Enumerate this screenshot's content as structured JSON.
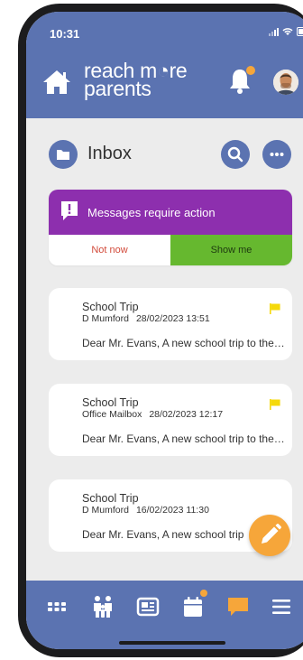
{
  "status_bar": {
    "time": "10:31"
  },
  "header": {
    "logo_line1": "reach m◔re",
    "logo_line2": "parents"
  },
  "inbox": {
    "title": "Inbox"
  },
  "banner": {
    "message": "Messages require action",
    "not_now_label": "Not now",
    "show_me_label": "Show me"
  },
  "messages": [
    {
      "subject": "School Trip",
      "sender": "D Mumford",
      "datetime": "28/02/2023 13:51",
      "preview": "Dear Mr. Evans, A new school trip to the Science Museum",
      "flagged": true
    },
    {
      "subject": "School Trip",
      "sender": "Office Mailbox",
      "datetime": "28/02/2023 12:17",
      "preview": "Dear Mr. Evans, A new school trip to the Science Museum",
      "flagged": true
    },
    {
      "subject": "School Trip",
      "sender": "D Mumford",
      "datetime": "16/02/2023 11:30",
      "preview": "Dear Mr. Evans, A new school trip",
      "flagged": false
    }
  ],
  "colors": {
    "primary": "#5b73b1",
    "banner_purple": "#8d2fae",
    "action_green": "#66b82f",
    "accent_orange": "#f6a63a",
    "flag_yellow": "#f5d90a",
    "danger_red": "#d24a3a"
  },
  "icons": {
    "header": [
      "home-icon",
      "bell-icon",
      "avatar"
    ],
    "bottom_nav": [
      "grid-icon",
      "family-icon",
      "news-icon",
      "calendar-icon",
      "chat-icon",
      "menu-icon"
    ]
  }
}
